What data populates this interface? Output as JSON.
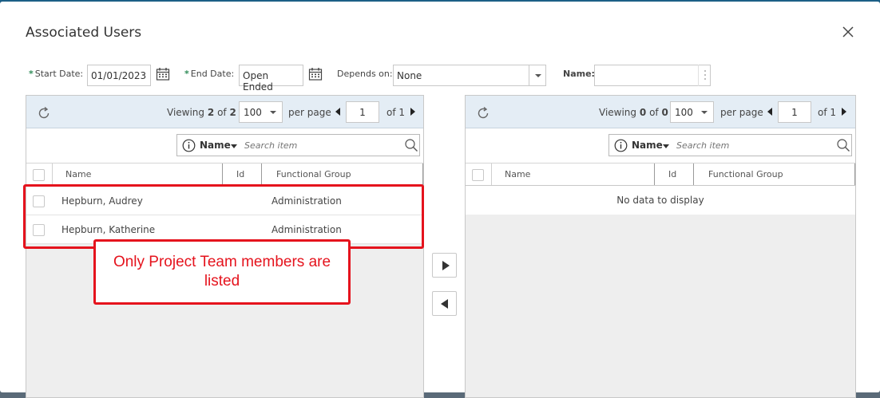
{
  "dialog": {
    "title": "Associated Users",
    "close_icon": "close-icon"
  },
  "filters": {
    "start_date_label": "Start Date:",
    "start_date_value": "01/01/2023",
    "end_date_label": "End Date:",
    "end_date_value": "Open Ended",
    "depends_on_label": "Depends on:",
    "depends_on_value": "None",
    "name_label": "Name:",
    "name_value": "",
    "required_marker": "*"
  },
  "left_panel": {
    "viewing_label": "Viewing",
    "viewing_count": "2",
    "of_word": "of",
    "viewing_total": "2",
    "per_page_value": "100",
    "per_page_label": "per page",
    "page_value": "1",
    "of_pages": "of 1",
    "search_field": "Name",
    "search_placeholder": "Search item",
    "columns": [
      "Name",
      "Id",
      "Functional Group"
    ],
    "rows": [
      {
        "name": "Hepburn, Audrey",
        "id": "",
        "group": "Administration"
      },
      {
        "name": "Hepburn, Katherine",
        "id": "",
        "group": "Administration"
      }
    ]
  },
  "right_panel": {
    "viewing_label": "Viewing",
    "viewing_count": "0",
    "of_word": "of",
    "viewing_total": "0",
    "per_page_value": "100",
    "per_page_label": "per page",
    "page_value": "1",
    "of_pages": "of 1",
    "search_field": "Name",
    "search_placeholder": "Search item",
    "columns": [
      "Name",
      "Id",
      "Functional Group"
    ],
    "empty_text": "No data to display"
  },
  "annotation": {
    "callout_text": "Only Project Team members are listed",
    "color": "#e5131d"
  },
  "colors": {
    "toolbar_bg": "#e4edf5",
    "required_star": "#2e8b57"
  }
}
